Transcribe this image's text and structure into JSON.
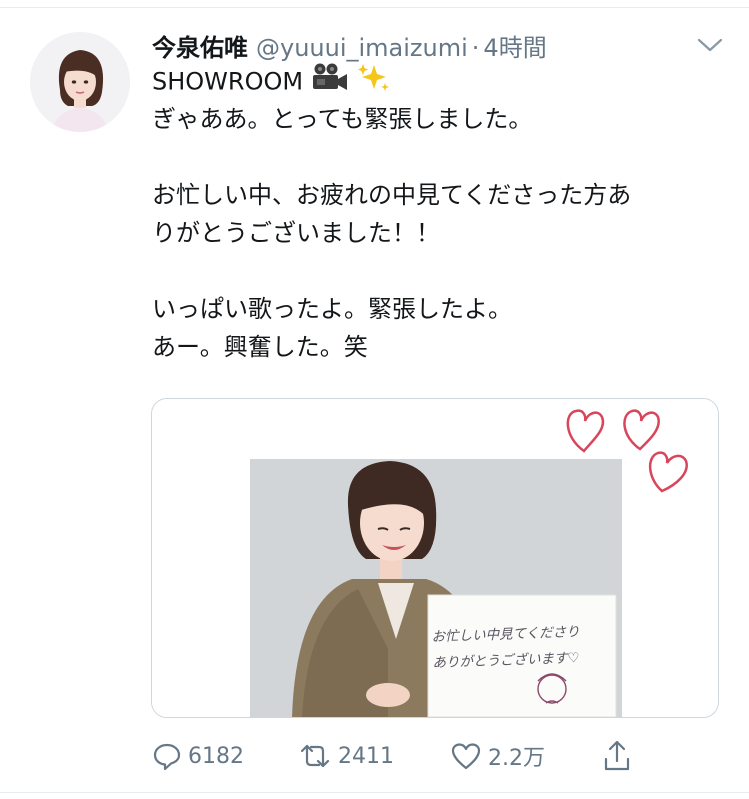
{
  "tweet": {
    "display_name": "今泉佑唯",
    "handle": "@yuuui_imaizumi",
    "separator": "·",
    "time": "4時間",
    "text_lines": [
      "SHOWROOM",
      "ぎゃああ。とっても緊張しました。",
      "",
      "お忙しい中、お疲れの中見てくださった方あ",
      "りがとうございました！！",
      "",
      "いっぱい歌ったよ。緊張したよ。",
      "あー。興奮した。笑"
    ],
    "emoji": [
      "movie-camera-icon",
      "sparkles-icon"
    ]
  },
  "media": {
    "handwritten_note_line1": "お忙しい中見てくださり",
    "handwritten_note_line2": "ありがとうございます♡"
  },
  "actions": {
    "reply_count": "6182",
    "retweet_count": "2411",
    "like_count": "2.2万"
  },
  "colors": {
    "text": "#14171a",
    "secondary": "#657786",
    "border": "#ccd6dd",
    "heart_red": "#d9455a"
  }
}
